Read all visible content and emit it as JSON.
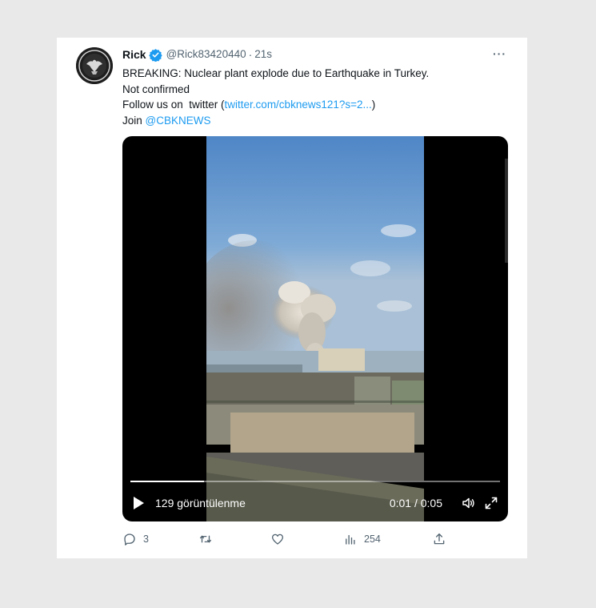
{
  "tweet": {
    "author_name": "Rick",
    "handle": "@Rick83420440",
    "separator": "·",
    "time": "21s",
    "more_label": "···",
    "text": {
      "line1": "BREAKING: Nuclear plant explode due to Earthquake in Turkey.",
      "line2": "Not confirmed",
      "line3_prefix": "Follow us on  twitter (",
      "line3_link": "twitter.com/cbknews121?s=2...",
      "line3_suffix": ")",
      "line4_prefix": "Join ",
      "line4_link": "@CBKNEWS"
    }
  },
  "video": {
    "views_label": "129 görüntülenme",
    "timecode": "0:01 / 0:05",
    "progress_fraction": 0.2
  },
  "actions": {
    "replies": "3",
    "retweets": "",
    "likes": "",
    "views": "254"
  },
  "colors": {
    "accent": "#1d9bf0",
    "secondary_text": "#536471",
    "background": "#e9e9e9"
  },
  "icons": [
    "verified-badge-icon",
    "more-icon",
    "play-icon",
    "volume-icon",
    "fullscreen-icon",
    "reply-icon",
    "retweet-icon",
    "like-icon",
    "analytics-icon",
    "share-icon"
  ]
}
